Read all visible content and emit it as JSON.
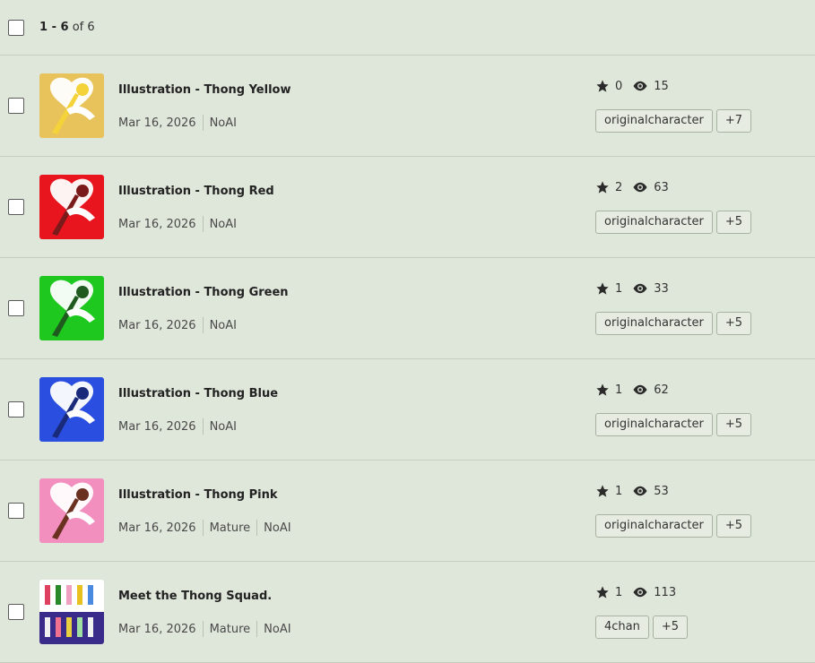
{
  "header": {
    "range": "1 - 6",
    "of_text": "of 6"
  },
  "rows": [
    {
      "title": "Illustration - Thong Yellow",
      "date": "Mar 16, 2026",
      "labels": [
        "NoAI"
      ],
      "favorites": "0",
      "views": "15",
      "tags": [
        "originalcharacter",
        "+7"
      ],
      "thumb": {
        "bg": "#e8c25a",
        "accent": "#ffffff",
        "figure": "#f4d23a"
      }
    },
    {
      "title": "Illustration - Thong Red",
      "date": "Mar 16, 2026",
      "labels": [
        "NoAI"
      ],
      "favorites": "2",
      "views": "63",
      "tags": [
        "originalcharacter",
        "+5"
      ],
      "thumb": {
        "bg": "#e8141e",
        "accent": "#ffffff",
        "figure": "#7a1a1a"
      }
    },
    {
      "title": "Illustration - Thong Green",
      "date": "Mar 16, 2026",
      "labels": [
        "NoAI"
      ],
      "favorites": "1",
      "views": "33",
      "tags": [
        "originalcharacter",
        "+5"
      ],
      "thumb": {
        "bg": "#1ec81e",
        "accent": "#ffffff",
        "figure": "#1f5a1f"
      }
    },
    {
      "title": "Illustration - Thong Blue",
      "date": "Mar 16, 2026",
      "labels": [
        "NoAI"
      ],
      "favorites": "1",
      "views": "62",
      "tags": [
        "originalcharacter",
        "+5"
      ],
      "thumb": {
        "bg": "#2a4fe0",
        "accent": "#ffffff",
        "figure": "#1a2a7a"
      }
    },
    {
      "title": "Illustration - Thong Pink",
      "date": "Mar 16, 2026",
      "labels": [
        "Mature",
        "NoAI"
      ],
      "favorites": "1",
      "views": "53",
      "tags": [
        "originalcharacter",
        "+5"
      ],
      "thumb": {
        "bg": "#f28fbf",
        "accent": "#ffffff",
        "figure": "#6a3020"
      }
    },
    {
      "title": "Meet the Thong Squad.",
      "date": "Mar 16, 2026",
      "labels": [
        "Mature",
        "NoAI"
      ],
      "favorites": "1",
      "views": "113",
      "tags": [
        "4chan",
        "+5"
      ],
      "thumb": {
        "bg": "#ffffff",
        "accent": "#3a2a8a",
        "figure": "#e04060"
      }
    }
  ],
  "icons": {
    "favorite": "star-icon",
    "views": "eye-icon"
  },
  "colors": {
    "background": "#dfe6da",
    "divider": "#c6cfbf",
    "tag_border": "#a8b2a1"
  }
}
